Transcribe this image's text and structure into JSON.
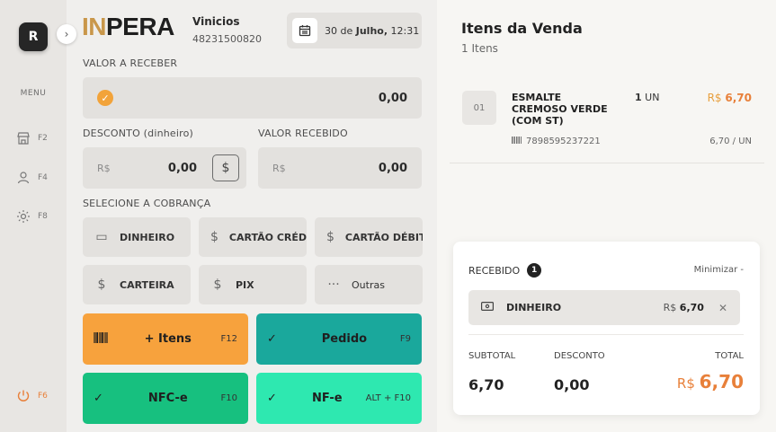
{
  "sidebar": {
    "avatar_initial": "R",
    "menu_title": "MENU",
    "items": [
      {
        "key": "F2",
        "icon": "store-icon"
      },
      {
        "key": "F4",
        "icon": "user-icon"
      },
      {
        "key": "F8",
        "icon": "gear-icon"
      }
    ],
    "power_key": "F6"
  },
  "header": {
    "logo_accent": "IN",
    "logo_rest": "PERA",
    "user_name": "Vinicios",
    "user_phone": "48231500820",
    "date_prefix": "30 de",
    "date_month": "Julho,",
    "time": "12:31"
  },
  "form": {
    "valor_receber_label": "VALOR A RECEBER",
    "valor_receber": "0,00",
    "desconto_label": "DESCONTO (dinheiro)",
    "desconto_currency": "R$",
    "desconto_value": "0,00",
    "valor_recebido_label": "VALOR RECEBIDO",
    "recebido_currency": "R$",
    "recebido_value": "0,00",
    "cobranca_label": "SELECIONE A COBRANÇA"
  },
  "payments": [
    {
      "label": "DINHEIRO",
      "icon": "cash-icon"
    },
    {
      "label": "CARTÃO CRÉDITO",
      "icon": "dollar-icon"
    },
    {
      "label": "CARTÃO DÉBITO",
      "icon": "dollar-icon"
    },
    {
      "label": "CARTEIRA",
      "icon": "dollar-icon"
    },
    {
      "label": "PIX",
      "icon": "dollar-icon"
    },
    {
      "label": "Outras",
      "icon": "dots-icon"
    }
  ],
  "actions": {
    "itens": {
      "label": "+ Itens",
      "key": "F12"
    },
    "pedido": {
      "label": "Pedido",
      "key": "F9"
    },
    "nfce": {
      "label": "NFC-e",
      "key": "F10"
    },
    "nfe": {
      "label": "NF-e",
      "key": "ALT + F10"
    }
  },
  "colors": {
    "orange": "#f7a23d",
    "teal": "#1aa89c",
    "green": "#17c07f",
    "mint": "#2ee8b0",
    "accent": "#e8803a"
  },
  "sale": {
    "title": "Itens da Venda",
    "count": "1 Itens",
    "items": [
      {
        "number": "01",
        "name": "ESMALTE CREMOSO VERDE (COM ST)",
        "qty": "1",
        "unit_label": "UN",
        "currency": "R$",
        "price": "6,70",
        "barcode": "7898595237221",
        "unit_price": "6,70 / UN"
      }
    ]
  },
  "summary": {
    "recebido_label": "RECEBIDO",
    "recebido_count": "1",
    "minimize_label": "Minimizar -",
    "received": {
      "method": "DINHEIRO",
      "currency": "R$",
      "amount": "6,70"
    },
    "subtotal_label": "SUBTOTAL",
    "subtotal": "6,70",
    "desconto_label": "DESCONTO",
    "desconto": "0,00",
    "total_label": "TOTAL",
    "total_currency": "R$",
    "total": "6,70"
  }
}
